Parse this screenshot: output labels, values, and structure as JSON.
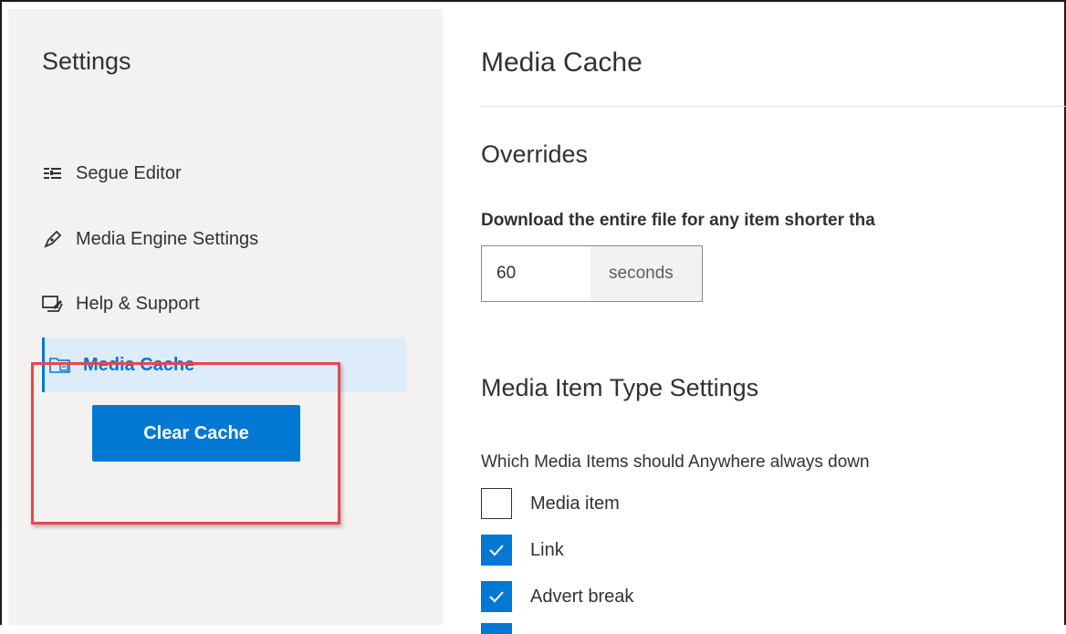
{
  "sidebar": {
    "title": "Settings",
    "items": [
      {
        "label": "Segue Editor",
        "icon": "segue-editor-icon"
      },
      {
        "label": "Media Engine Settings",
        "icon": "pen-icon"
      },
      {
        "label": "Help & Support",
        "icon": "help-support-icon"
      },
      {
        "label": "Media Cache",
        "icon": "media-cache-icon",
        "selected": true
      }
    ],
    "clear_button": "Clear Cache"
  },
  "main": {
    "title": "Media Cache",
    "overrides": {
      "heading": "Overrides",
      "download_label": "Download the entire file for any item shorter tha",
      "seconds_value": "60",
      "seconds_suffix": "seconds"
    },
    "media_types": {
      "heading": "Media Item Type Settings",
      "question": "Which Media Items should Anywhere always down",
      "options": [
        {
          "label": "Media item",
          "checked": false
        },
        {
          "label": "Link",
          "checked": true
        },
        {
          "label": "Advert break",
          "checked": true
        }
      ]
    }
  },
  "colors": {
    "accent": "#0078d4",
    "highlight": "#e8464e",
    "sidebar_bg": "#f3f2f1"
  }
}
